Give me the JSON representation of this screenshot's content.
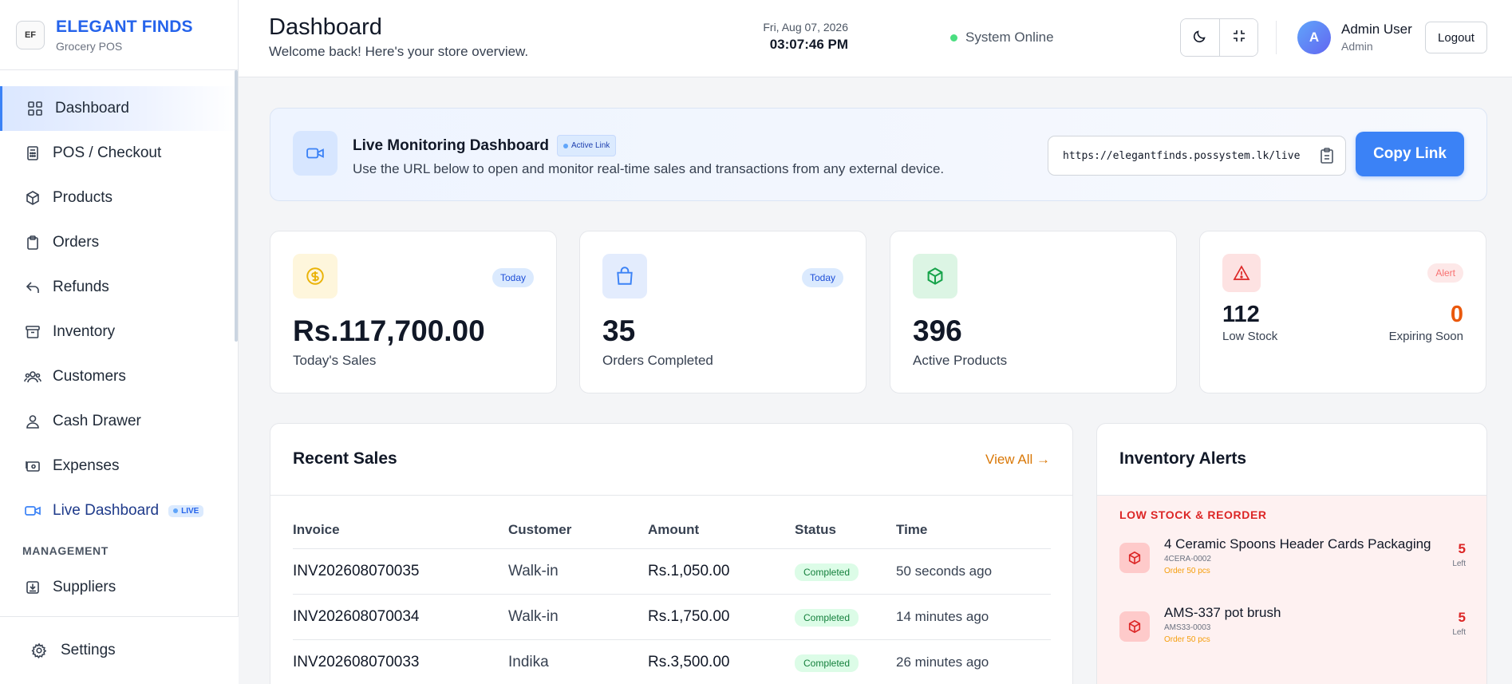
{
  "brand": {
    "name": "ELEGANT FINDS",
    "subtitle": "Grocery POS",
    "logo_text": "EF"
  },
  "sidebar": {
    "items": [
      {
        "label": "Dashboard",
        "icon": "grid-icon",
        "active": true
      },
      {
        "label": "POS / Checkout",
        "icon": "calculator-icon"
      },
      {
        "label": "Products",
        "icon": "box-icon"
      },
      {
        "label": "Orders",
        "icon": "clipboard-icon"
      },
      {
        "label": "Refunds",
        "icon": "undo-arrow-icon"
      },
      {
        "label": "Inventory",
        "icon": "archive-icon"
      },
      {
        "label": "Customers",
        "icon": "users-icon"
      },
      {
        "label": "Cash Drawer",
        "icon": "user-circle-icon"
      },
      {
        "label": "Expenses",
        "icon": "wallet-icon"
      },
      {
        "label": "Live Dashboard",
        "icon": "video-icon",
        "badge": "LIVE"
      }
    ],
    "section_label": "MANAGEMENT",
    "management_items": [
      {
        "label": "Suppliers",
        "icon": "inbox-icon"
      }
    ],
    "settings_label": "Settings"
  },
  "header": {
    "title": "Dashboard",
    "subtitle": "Welcome back! Here's your store overview.",
    "status": "System Online",
    "date": "Fri, Aug 07, 2026",
    "time": "03:07:46 PM",
    "avatar_initial": "A",
    "user_name": "Admin User",
    "user_role": "Admin",
    "logout_label": "Logout"
  },
  "monitor": {
    "title": "Live Monitoring Dashboard",
    "badge": "Active Link",
    "description": "Use the URL below to open and monitor real-time sales and transactions from any external device.",
    "url": "https://elegantfinds.possystem.lk/live",
    "copy_label": "Copy Link"
  },
  "stats": {
    "sales": {
      "value": "Rs.117,700.00",
      "label": "Today's Sales",
      "badge": "Today"
    },
    "orders": {
      "value": "35",
      "label": "Orders Completed",
      "badge": "Today"
    },
    "products": {
      "value": "396",
      "label": "Active Products"
    },
    "alerts": {
      "badge": "Alert",
      "low_value": "112",
      "low_label": "Low Stock",
      "exp_value": "0",
      "exp_label": "Expiring Soon"
    }
  },
  "recent_sales": {
    "title": "Recent Sales",
    "view_all": "View All →",
    "columns": [
      "Invoice",
      "Customer",
      "Amount",
      "Status",
      "Time"
    ],
    "rows": [
      {
        "invoice": "INV202608070035",
        "customer": "Walk-in",
        "amount": "Rs.1,050.00",
        "status": "Completed",
        "time": "50 seconds ago"
      },
      {
        "invoice": "INV202608070034",
        "customer": "Walk-in",
        "amount": "Rs.1,750.00",
        "status": "Completed",
        "time": "14 minutes ago"
      },
      {
        "invoice": "INV202608070033",
        "customer": "Indika",
        "amount": "Rs.3,500.00",
        "status": "Completed",
        "time": "26 minutes ago"
      }
    ]
  },
  "inventory_alerts": {
    "title": "Inventory Alerts",
    "section": "LOW STOCK & REORDER",
    "items": [
      {
        "name": "4 Ceramic Spoons Header Cards Packaging",
        "sku": "4CERA-0002",
        "order": "Order 50 pcs",
        "qty": "5",
        "left": "Left"
      },
      {
        "name": "AMS-337 pot brush",
        "sku": "AMS33-0003",
        "order": "Order 50 pcs",
        "qty": "5",
        "left": "Left"
      }
    ]
  },
  "colors": {
    "accent": "#3b82f6",
    "brand": "#2563eb",
    "warning": "#d97706",
    "danger": "#dc2626",
    "success": "#15803d"
  }
}
